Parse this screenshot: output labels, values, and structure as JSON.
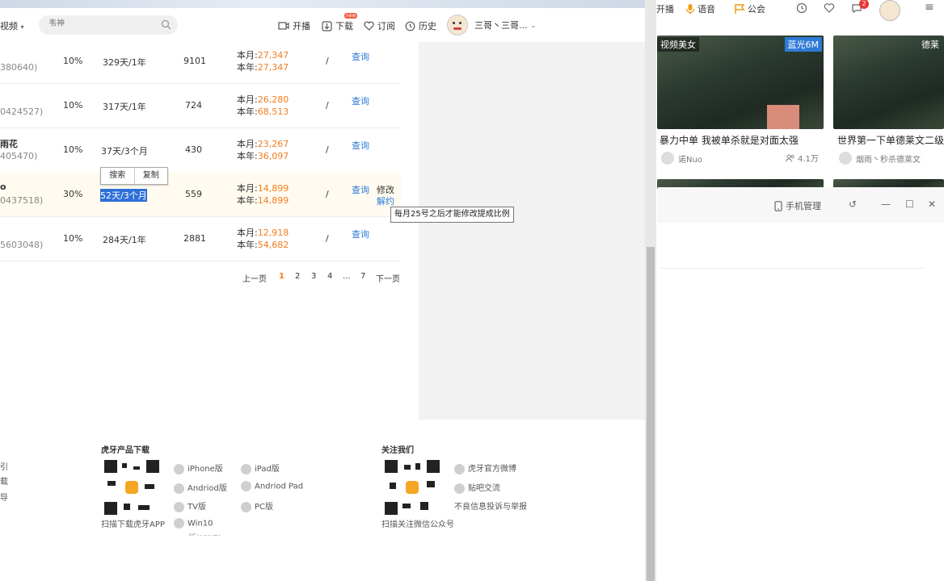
{
  "nav": {
    "category": "视频",
    "search_placeholder": "韦神",
    "kaibo": "开播",
    "download": "下载",
    "download_badge": "new",
    "subscribe": "订阅",
    "history": "历史",
    "user": "三哥丶三哥..."
  },
  "rows": [
    {
      "id": "380640)",
      "ratio": "10%",
      "time": "329天/1年",
      "count": "9101",
      "month_label": "本月:",
      "month": "27,347",
      "year_label": "本年:",
      "year": "27,347",
      "sep": "/",
      "action": "查询"
    },
    {
      "id": "0424527)",
      "ratio": "10%",
      "time": "317天/1年",
      "count": "724",
      "month_label": "本月:",
      "month": "26,280",
      "year_label": "本年:",
      "year": "68,513",
      "sep": "/",
      "action": "查询"
    },
    {
      "name": "雨花",
      "id": "405470)",
      "ratio": "10%",
      "time": "37天/3个月",
      "count": "430",
      "month_label": "本月:",
      "month": "23,267",
      "year_label": "本年:",
      "year": "36,097",
      "sep": "/",
      "action": "查询"
    },
    {
      "name": "o",
      "id": "0437518)",
      "ratio": "30%",
      "time": "52天/3个月",
      "count": "559",
      "month_label": "本月:",
      "month": "14,899",
      "year_label": "本年:",
      "year": "14,899",
      "sep": "/",
      "action": "查询",
      "extra1": "修改",
      "extra2": "解约"
    },
    {
      "id": "5603048)",
      "ratio": "10%",
      "time": "284天/1年",
      "count": "2881",
      "month_label": "本月:",
      "month": "12,918",
      "year_label": "本年:",
      "year": "54,682",
      "sep": "/",
      "action": "查询"
    }
  ],
  "context_menu": {
    "search": "搜索",
    "copy": "复制"
  },
  "tooltip": "每月25号之后才能修改提成比例",
  "pager": {
    "prev": "上一页",
    "pages": [
      "1",
      "2",
      "3",
      "4",
      "...",
      "7"
    ],
    "current": "1",
    "next": "下一页"
  },
  "footer": {
    "left_links": [
      "引",
      "载",
      "导"
    ],
    "download_title": "虎牙产品下载",
    "download_caption": "扫描下载虎牙APP",
    "apps": [
      "iPhone版",
      "iPad版",
      "Andriod版",
      "Andriod Pad",
      "TV版",
      "PC版",
      "Win10"
    ],
    "apps_cut": "版(UWP)",
    "follow_title": "关注我们",
    "follow_caption": "扫描关注微信公众号",
    "follow_links": [
      "虎牙官方微博",
      "贴吧交流",
      "不良信息投诉与举报"
    ]
  },
  "right": {
    "topbar": {
      "kaibo": "开播",
      "voice": "语音",
      "guild": "公会",
      "msg_badge": "2"
    },
    "cards": [
      {
        "badge_left": "视频美女",
        "badge_right": "蓝光6M",
        "title": "暴力中单 我被单杀就是对面太强",
        "author": "诺Nuo",
        "viewers": "4.1万"
      },
      {
        "badge_right": "德莱",
        "title": "世界第一下单德莱文二级",
        "author": "烟雨丶秒杀德莱文"
      }
    ],
    "popup": {
      "phone_manage": "手机管理"
    }
  },
  "colors": {
    "accent_orange": "#f37b1d",
    "link_blue": "#2b7bd6",
    "selection": "#2e6fd8"
  }
}
